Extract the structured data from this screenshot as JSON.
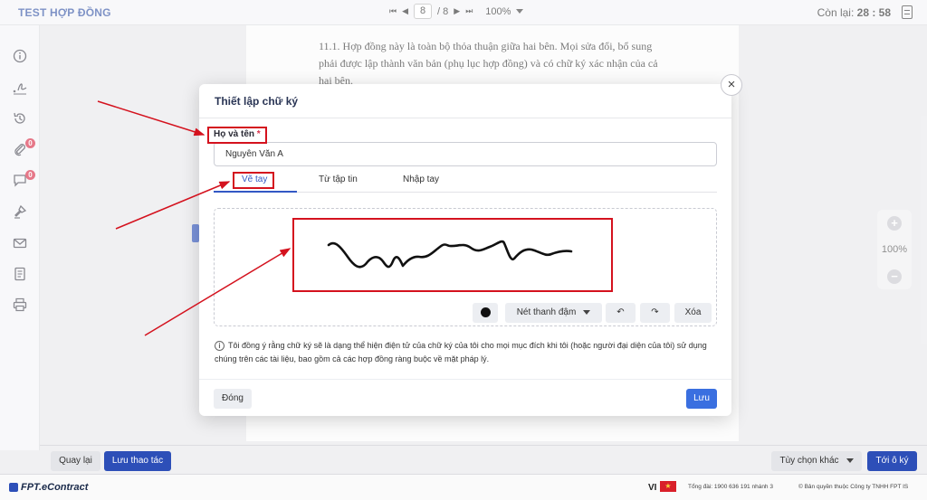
{
  "header": {
    "title": "TEST HỢP ĐỒNG",
    "current_page": "8",
    "page_total": "/ 8",
    "zoom": "100%",
    "timer_label": "Còn lại:",
    "timer_value": "28 : 58"
  },
  "document": {
    "text": "11.1. Hợp đồng này là toàn bộ thỏa thuận giữa hai bên. Mọi sửa đổi, bổ sung phải được lập thành văn bản (phụ lục hợp đồng) và có chữ ký xác nhận của cả hai bên."
  },
  "sidebar": {
    "attachments_badge": "0",
    "comments_badge": "0"
  },
  "zoom_panel": {
    "level": "100%"
  },
  "modal": {
    "title": "Thiết lập chữ ký",
    "close_icon": "×",
    "name_label": "Họ và tên",
    "required_mark": "*",
    "name_value": "Nguyễn Văn A",
    "tabs": [
      {
        "label": "Vẽ tay",
        "active": true
      },
      {
        "label": "Từ tập tin",
        "active": false
      },
      {
        "label": "Nhập tay",
        "active": false
      }
    ],
    "tools": {
      "stroke_label": "Nét thanh đậm",
      "undo": "↶",
      "redo": "↷",
      "clear": "Xóa"
    },
    "consent": "Tôi đồng ý rằng chữ ký sẽ là dạng thể hiện điện tử của chữ ký của tôi cho mọi mục đích khi tôi (hoặc người đại diện của tôi) sử dụng chúng trên các tài liệu, bao gồm cả các hợp đồng ràng buộc về mặt pháp lý.",
    "close_button": "Đóng",
    "save_button": "Lưu"
  },
  "actions": {
    "back": "Quay lại",
    "save_action": "Lưu thao tác",
    "other_options": "Tùy chọn khác",
    "go_sign": "Tới ô ký"
  },
  "footer": {
    "brand": "FPT.eContract",
    "language": "VI",
    "hotline": "Tổng đài: 1900 636 191 nhánh 3",
    "copyright": "© Bản quyền thuộc Công ty TNHH FPT IS"
  },
  "colors": {
    "primary": "#3358c4",
    "highlight": "#d4121e",
    "badge": "#d9304b"
  }
}
